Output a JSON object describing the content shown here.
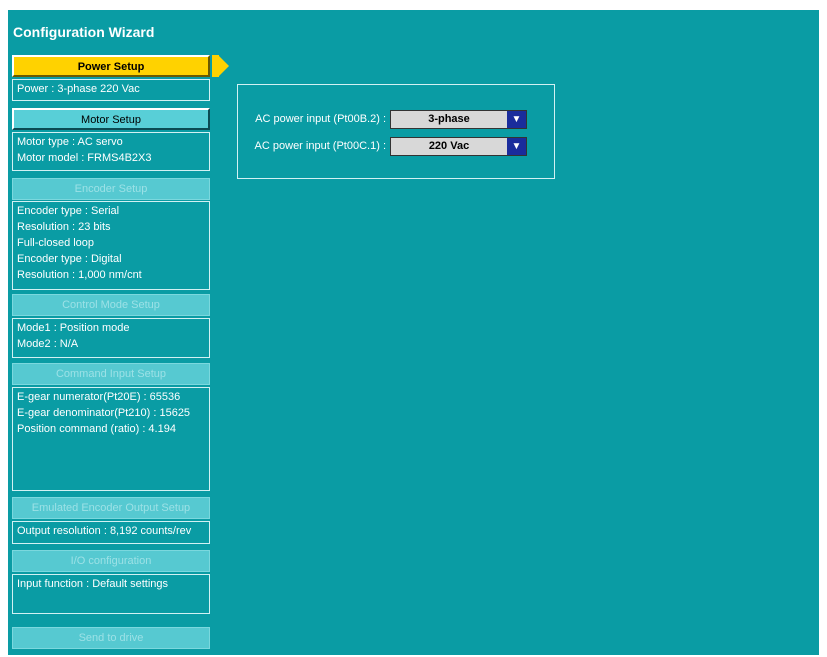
{
  "title": "Configuration Wizard",
  "sections": {
    "power": {
      "button_label": "Power Setup",
      "lines": [
        "Power : 3-phase 220 Vac"
      ]
    },
    "motor": {
      "button_label": "Motor Setup",
      "lines": [
        "Motor type : AC servo",
        "Motor model  : FRMS4B2X3"
      ]
    },
    "encoder": {
      "button_label": "Encoder Setup",
      "lines": [
        "Encoder type : Serial",
        "Resolution : 23 bits",
        "Full-closed loop",
        "Encoder type : Digital",
        "Resolution : 1,000 nm/cnt"
      ]
    },
    "control_mode": {
      "button_label": "Control Mode Setup",
      "lines": [
        "Mode1 : Position mode",
        "Mode2 : N/A"
      ]
    },
    "command_input": {
      "button_label": "Command Input Setup",
      "lines": [
        "E-gear numerator(Pt20E) : 65536",
        "E-gear denominator(Pt210) : 15625",
        "Position command (ratio) : 4.194"
      ]
    },
    "emulated_encoder": {
      "button_label": "Emulated Encoder Output Setup",
      "lines": [
        "Output resolution : 8,192 counts/rev"
      ]
    },
    "io": {
      "button_label": "I/O configuration",
      "lines": [
        "Input function : Default settings"
      ]
    },
    "send": {
      "button_label": "Send to drive"
    }
  },
  "power_panel": {
    "rows": [
      {
        "label": "AC power input (Pt00B.2) :",
        "value": "3-phase"
      },
      {
        "label": "AC power input (Pt00C.1) :",
        "value": "220 Vac"
      }
    ],
    "dropdown_arrow": "▼"
  },
  "colors": {
    "background": "#0a9ca4",
    "active_button": "#ffd200",
    "enabled_button": "#58cfd7",
    "dropdown_arrow": "#1a2c9c"
  }
}
